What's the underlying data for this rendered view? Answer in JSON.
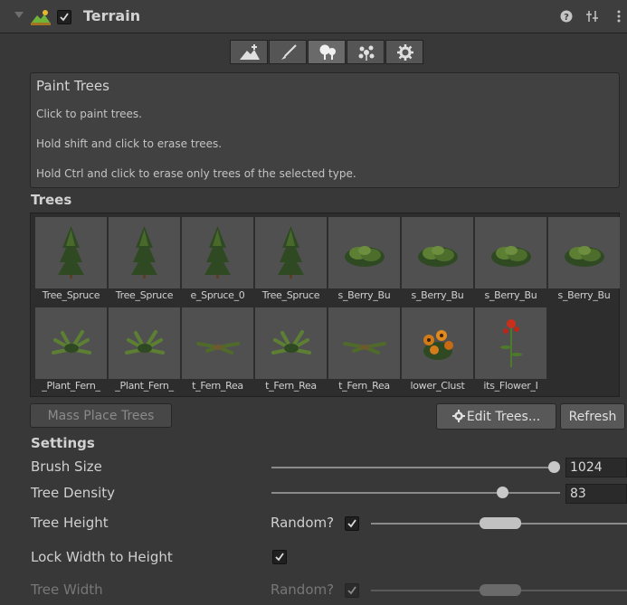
{
  "header": {
    "title": "Terrain",
    "enabled": true,
    "icons": [
      "help-icon",
      "preset-icon",
      "more-icon"
    ]
  },
  "toolbar": {
    "tools": [
      {
        "name": "raise-terrain-icon",
        "active": false
      },
      {
        "name": "paint-brush-icon",
        "active": false
      },
      {
        "name": "paint-trees-icon",
        "active": true
      },
      {
        "name": "paint-details-icon",
        "active": false
      },
      {
        "name": "settings-gear-icon",
        "active": false
      }
    ]
  },
  "help": {
    "title": "Paint Trees",
    "line1": "Click to paint trees.",
    "line2": "Hold shift and click to erase trees.",
    "line3": "Hold Ctrl and click to erase only trees of the selected type."
  },
  "trees": {
    "heading": "Trees",
    "items": [
      {
        "label": "Tree_Spruce",
        "kind": "spruce"
      },
      {
        "label": "Tree_Spruce",
        "kind": "spruce"
      },
      {
        "label": "e_Spruce_0",
        "kind": "spruce"
      },
      {
        "label": "Tree_Spruce",
        "kind": "spruce"
      },
      {
        "label": "s_Berry_Bu",
        "kind": "bush"
      },
      {
        "label": "s_Berry_Bu",
        "kind": "bush"
      },
      {
        "label": "s_Berry_Bu",
        "kind": "bush"
      },
      {
        "label": "s_Berry_Bu",
        "kind": "bush"
      },
      {
        "label": "_Plant_Fern_",
        "kind": "fern"
      },
      {
        "label": "_Plant_Fern_",
        "kind": "fern"
      },
      {
        "label": "t_Fern_Rea",
        "kind": "fernlow"
      },
      {
        "label": "t_Fern_Rea",
        "kind": "fern"
      },
      {
        "label": "t_Fern_Rea",
        "kind": "fernlow"
      },
      {
        "label": "lower_Clust",
        "kind": "flowers"
      },
      {
        "label": "its_Flower_I",
        "kind": "flower"
      }
    ]
  },
  "buttons": {
    "mass_place": "Mass Place Trees",
    "edit_trees": "Edit Trees...",
    "refresh": "Refresh"
  },
  "settings": {
    "heading": "Settings",
    "brush_size_label": "Brush Size",
    "brush_size_value": "1024",
    "brush_size_fraction": 1.0,
    "tree_density_label": "Tree Density",
    "tree_density_value": "83",
    "tree_density_fraction": 0.83,
    "tree_height_label": "Tree Height",
    "tree_height_random_label": "Random?",
    "tree_height_random": true,
    "lock_label": "Lock Width to Height",
    "lock_checked": true,
    "tree_width_label": "Tree Width",
    "tree_width_random_label": "Random?",
    "tree_width_random": true
  },
  "colors": {
    "background": "#383838",
    "header": "#3e3e3e",
    "foliage_dark": "#2f4a22",
    "foliage_light": "#5c7f34",
    "flower": "#d07a18"
  }
}
